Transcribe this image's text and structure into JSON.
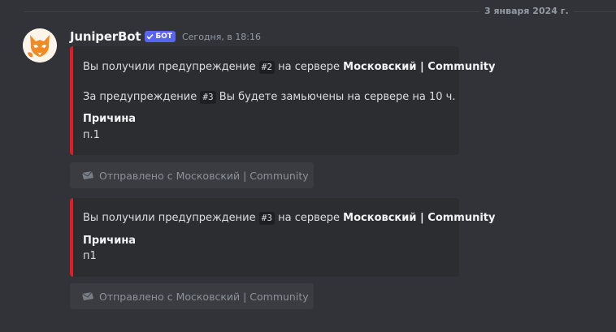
{
  "divider": {
    "date": "3 января 2024 г."
  },
  "message": {
    "author": "JuniperBot",
    "bot_tag": "БОТ",
    "timestamp": "Сегодня, в 18:16"
  },
  "embeds": [
    {
      "accent_color": "#e11c24",
      "line1": {
        "pre": "Вы получили предупреждение ",
        "code": "#2",
        "mid": " на сервере ",
        "bold": "Московский | Community"
      },
      "line2": {
        "pre": "За предупреждение ",
        "code": "#3",
        "post": " Вы будете замьючены на сервере на 10 ч."
      },
      "field_name": "Причина",
      "field_value": "п.1"
    },
    {
      "accent_color": "#e11c24",
      "line1": {
        "pre": "Вы получили предупреждение ",
        "code": "#3",
        "mid": " на сервере ",
        "bold": "Московский | Community"
      },
      "field_name": "Причина",
      "field_value": "п1"
    }
  ],
  "sent_buttons": [
    {
      "icon": "envelope-icon",
      "label": "Отправлено с Московский | Community",
      "disabled": true
    },
    {
      "icon": "envelope-icon",
      "label": "Отправлено с Московский | Community",
      "disabled": true
    }
  ]
}
